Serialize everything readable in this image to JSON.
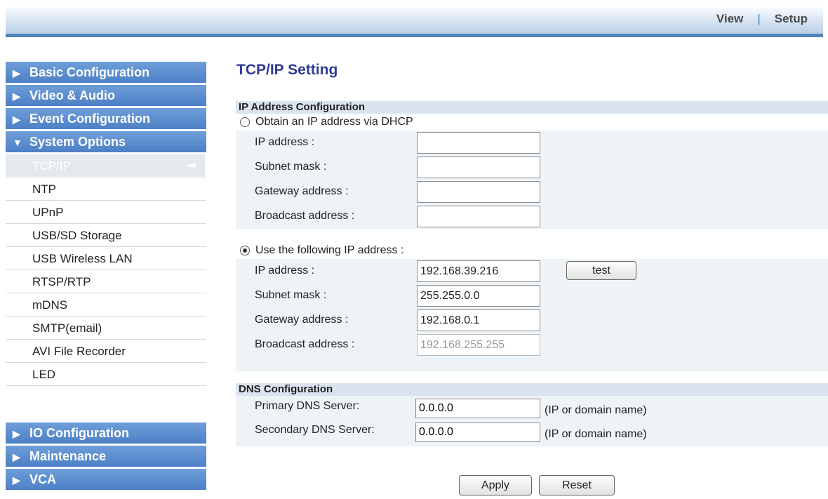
{
  "topnav": {
    "view": "View",
    "separator": "|",
    "setup": "Setup"
  },
  "sidebar": {
    "sections_top": [
      {
        "label": "Basic Configuration",
        "arrow": "▶"
      },
      {
        "label": "Video & Audio",
        "arrow": "▶"
      },
      {
        "label": "Event Configuration",
        "arrow": "▶"
      },
      {
        "label": "System Options",
        "arrow": "▼"
      }
    ],
    "items": [
      {
        "label": "TCP/IP",
        "active": true,
        "go_icon": "➡"
      },
      {
        "label": "NTP"
      },
      {
        "label": "UPnP"
      },
      {
        "label": "USB/SD Storage"
      },
      {
        "label": "USB Wireless LAN"
      },
      {
        "label": "RTSP/RTP"
      },
      {
        "label": "mDNS"
      },
      {
        "label": "SMTP(email)"
      },
      {
        "label": "AVI File Recorder"
      },
      {
        "label": "LED"
      }
    ],
    "sections_bottom": [
      {
        "label": "IO Configuration",
        "arrow": "▶"
      },
      {
        "label": "Maintenance",
        "arrow": "▶"
      },
      {
        "label": "VCA",
        "arrow": "▶"
      }
    ]
  },
  "page_title": "TCP/IP Setting",
  "ip_config": {
    "heading": "IP Address Configuration",
    "dhcp": {
      "label": "Obtain an IP address via DHCP",
      "checked": false,
      "ip_label": "IP address :",
      "ip_value": "",
      "subnet_label": "Subnet mask :",
      "subnet_value": "",
      "gateway_label": "Gateway address :",
      "gateway_value": "",
      "broadcast_label": "Broadcast address :",
      "broadcast_value": ""
    },
    "static": {
      "label": "Use the following IP address :",
      "checked": true,
      "ip_label": "IP address :",
      "ip_value": "192.168.39.216",
      "test_button": "test",
      "subnet_label": "Subnet mask :",
      "subnet_value": "255.255.0.0",
      "gateway_label": "Gateway address :",
      "gateway_value": "192.168.0.1",
      "broadcast_label": "Broadcast address :",
      "broadcast_value": "192.168.255.255"
    }
  },
  "dns_config": {
    "heading": "DNS Configuration",
    "primary_label": "Primary DNS Server:",
    "primary_value": "0.0.0.0",
    "secondary_label": "Secondary DNS Server:",
    "secondary_value": "0.0.0.0",
    "hint": "(IP or domain name)"
  },
  "buttons": {
    "apply": "Apply",
    "reset": "Reset"
  }
}
